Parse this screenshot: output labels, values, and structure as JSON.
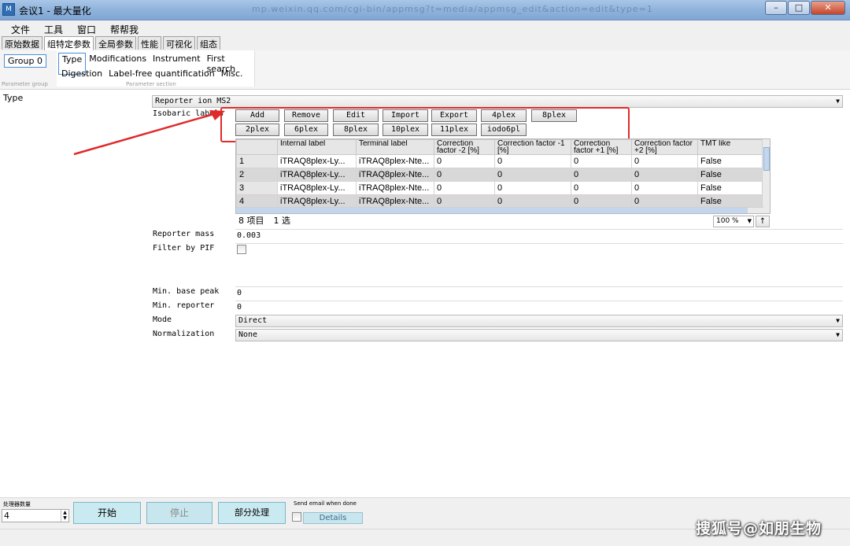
{
  "window": {
    "title": "会议1 - 最大量化",
    "blurred_url": "mp.weixin.qq.com/cgi-bin/appmsg?t=media/appmsg_edit&action=edit&type=1"
  },
  "menu": [
    "文件",
    "工具",
    "窗口",
    "帮帮我"
  ],
  "tabs": [
    "原始数据",
    "组特定参数",
    "全局参数",
    "性能",
    "可视化",
    "组态"
  ],
  "active_tab_index": 1,
  "ribbon": {
    "group": "Group 0",
    "group_caption": "Parameter group",
    "section_caption": "Parameter section",
    "sections_row1": [
      "Type",
      "Modifications",
      "Instrument",
      "First search"
    ],
    "sections_row2": [
      "Digestion",
      "Label-free quantification",
      "Misc."
    ]
  },
  "form": {
    "type_label": "Type",
    "type_value": "Reporter ion MS2",
    "isobaric_label": "Isobaric labels",
    "buttons_row1": [
      "Add",
      "Remove",
      "Edit",
      "Import",
      "Export",
      "4plex",
      "8plex"
    ],
    "buttons_row2": [
      "2plex",
      "6plex",
      "8plex",
      "10plex",
      "11plex",
      "iodo6pl"
    ],
    "table": {
      "columns": [
        "Internal label",
        "Terminal label",
        "Correction factor -2 [%]",
        "Correction factor -1 [%]",
        "Correction factor +1 [%]",
        "Correction factor +2 [%]",
        "TMT like"
      ],
      "rows": [
        {
          "n": "1",
          "internal": "iTRAQ8plex-Ly...",
          "terminal": "iTRAQ8plex-Nte...",
          "c1": "0",
          "c2": "0",
          "c3": "0",
          "c4": "0",
          "tmt": "False"
        },
        {
          "n": "2",
          "internal": "iTRAQ8plex-Ly...",
          "terminal": "iTRAQ8plex-Nte...",
          "c1": "0",
          "c2": "0",
          "c3": "0",
          "c4": "0",
          "tmt": "False"
        },
        {
          "n": "3",
          "internal": "iTRAQ8plex-Ly...",
          "terminal": "iTRAQ8plex-Nte...",
          "c1": "0",
          "c2": "0",
          "c3": "0",
          "c4": "0",
          "tmt": "False"
        },
        {
          "n": "4",
          "internal": "iTRAQ8plex-Ly...",
          "terminal": "iTRAQ8plex-Nte...",
          "c1": "0",
          "c2": "0",
          "c3": "0",
          "c4": "0",
          "tmt": "False"
        }
      ],
      "count_text": "8 项目",
      "selected_text": "1 选",
      "zoom": "100 %"
    },
    "reporter_mass_label": "Reporter mass",
    "reporter_mass_value": "0.003",
    "filter_pif_label": "Filter by PIF",
    "filter_pif_checked": false,
    "min_base_peak_label": "Min. base peak",
    "min_base_peak_value": "0",
    "min_reporter_label": "Min. reporter",
    "min_reporter_value": "0",
    "mode_label": "Mode",
    "mode_value": "Direct",
    "normalization_label": "Normalization",
    "normalization_value": "None"
  },
  "bottom": {
    "processors_label": "处理器数量",
    "processors_value": "4",
    "start_label": "开始",
    "stop_label": "停止",
    "partial_label": "部分处理",
    "email_label": "Send email when done",
    "details_label": "Details"
  },
  "watermark": "搜狐号@如朋生物",
  "colors": {
    "highlight": "#e02a2a",
    "accent": "#4a8fd6",
    "button_bg": "#c9eaf0"
  }
}
